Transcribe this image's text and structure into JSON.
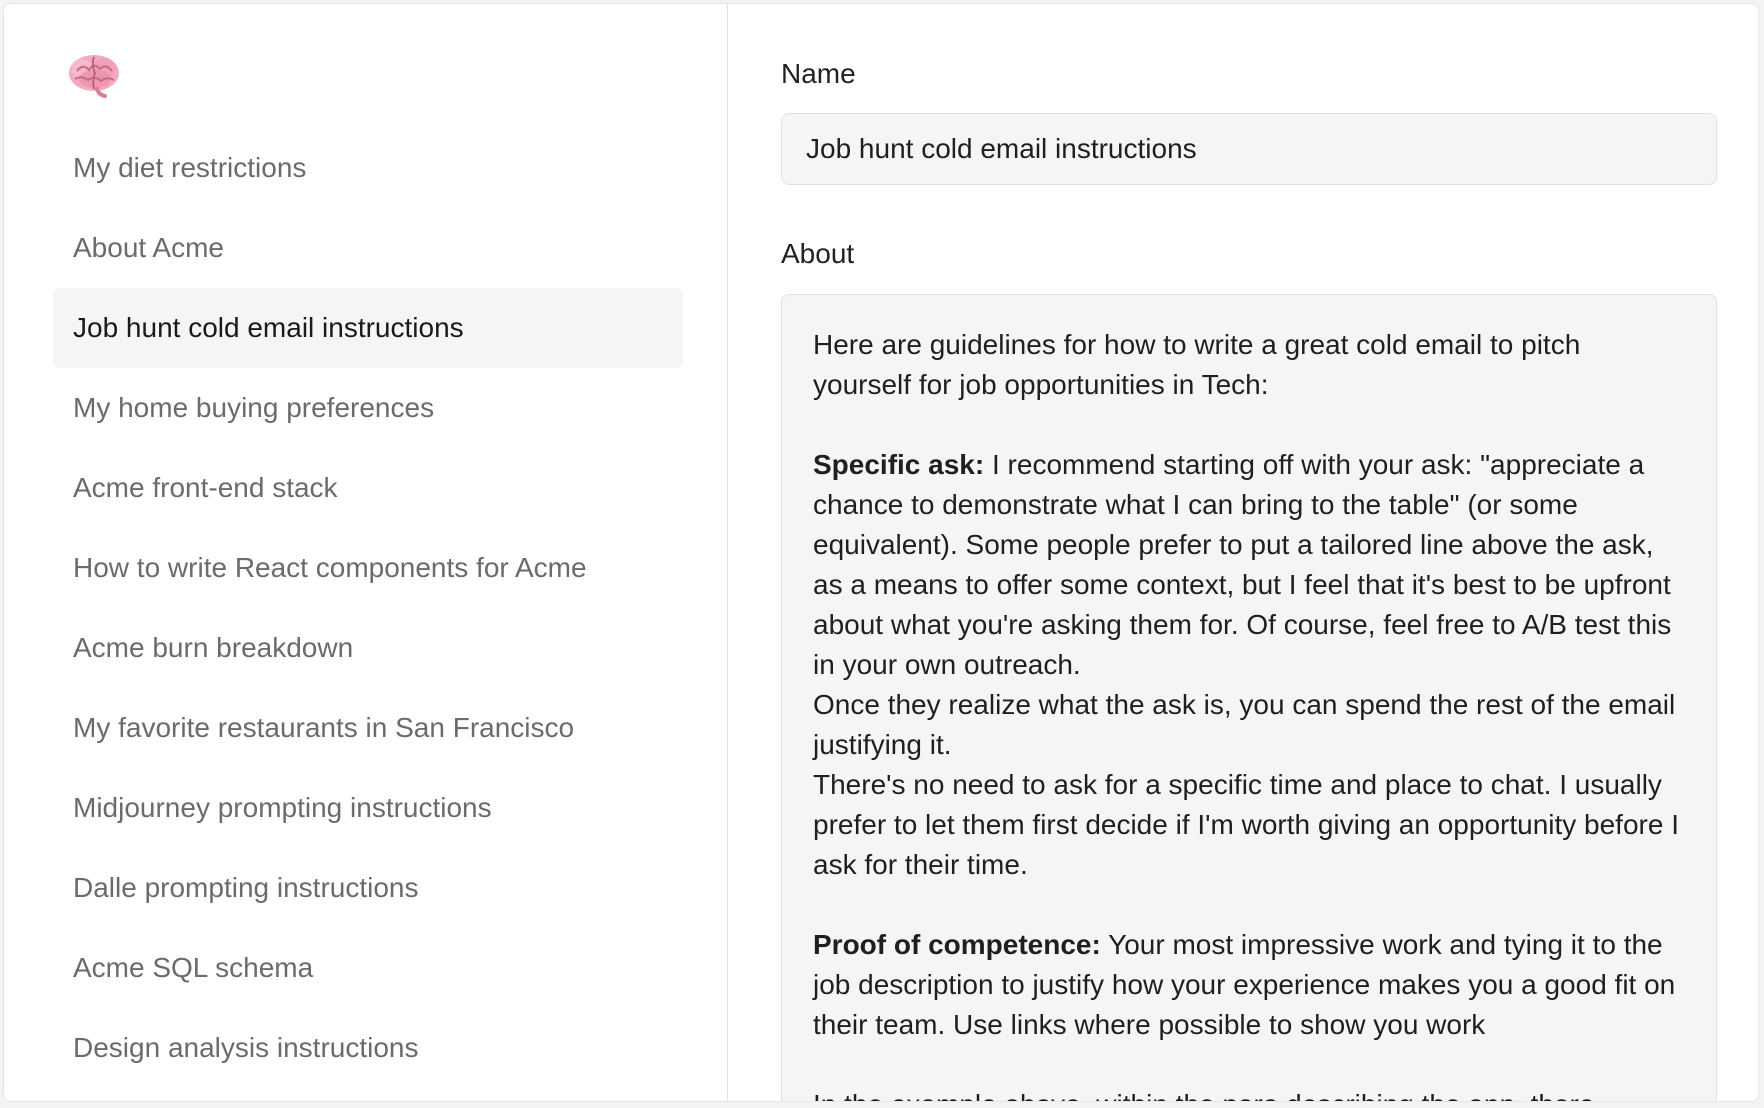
{
  "sidebar": {
    "logo_icon": "brain-icon",
    "items": [
      {
        "label": "My diet restrictions",
        "active": false
      },
      {
        "label": "About Acme",
        "active": false
      },
      {
        "label": "Job hunt cold email instructions",
        "active": true
      },
      {
        "label": "My home buying preferences",
        "active": false
      },
      {
        "label": "Acme front-end stack",
        "active": false
      },
      {
        "label": "How to write React components for Acme",
        "active": false
      },
      {
        "label": "Acme burn breakdown",
        "active": false
      },
      {
        "label": "My favorite restaurants in San Francisco",
        "active": false
      },
      {
        "label": "Midjourney prompting instructions",
        "active": false
      },
      {
        "label": "Dalle prompting instructions",
        "active": false
      },
      {
        "label": "Acme SQL schema",
        "active": false
      },
      {
        "label": "Design analysis instructions",
        "active": false
      }
    ]
  },
  "form": {
    "name_label": "Name",
    "name_value": "Job hunt cold email instructions",
    "about_label": "About",
    "about": {
      "intro": "Here are guidelines for how to write a great cold email to pitch yourself for job opportunities in Tech:",
      "specific_ask_heading": "Specific ask:",
      "specific_ask_text": " I recommend starting off with your ask: \"appreciate a chance to demonstrate what I can bring to the table\" (or some equivalent). Some people prefer to put a tailored line above the ask, as a means to offer some context, but I feel that it's best to be upfront about what you're asking them for. Of course, feel free to A/B test this in your own outreach.",
      "ask_line_2": "Once they realize what the ask is, you can spend the rest of the email justifying it.",
      "ask_line_3": "There's no need to ask for a specific time and place to chat. I usually prefer to let them first decide if I'm worth giving an opportunity before I ask for their time.",
      "proof_heading": "Proof of competence:",
      "proof_text": " Your most impressive work and tying it to the job description to justify how your experience makes you a good fit on their team. Use links where possible to show you work",
      "trailing": "In the example above, within the para describing the app, there"
    }
  },
  "colors": {
    "active_bg": "#f5f5f5",
    "muted_text": "#6b6b6b",
    "input_bg": "#f5f5f5"
  }
}
